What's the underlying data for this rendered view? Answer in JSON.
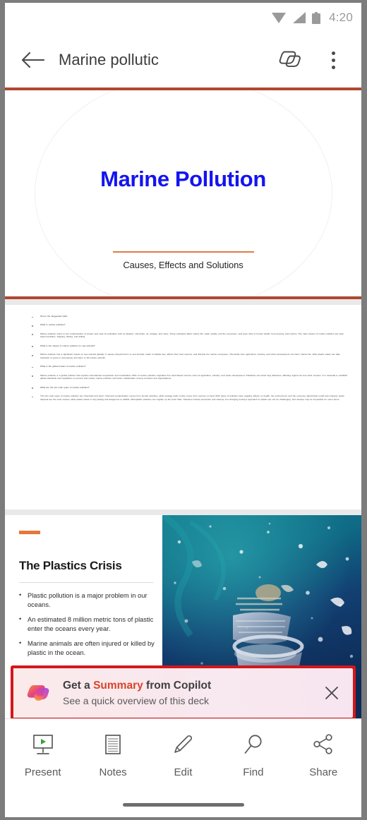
{
  "status_bar": {
    "time": "4:20",
    "icons": [
      "wifi-icon",
      "cellular-signal-icon",
      "battery-icon"
    ]
  },
  "app_bar": {
    "back_label": "back-arrow-icon",
    "title": "Marine pollutic",
    "copilot_action": "copilot-icon",
    "overflow_action": "more-options-icon"
  },
  "slides": [
    {
      "index": 1,
      "type": "title-slide",
      "title": "Marine Pollution",
      "subtitle": "Causes, Effects and Solutions",
      "title_color": "#1414f0",
      "accent_color": "#e07b4a",
      "border_color": "#b0482f"
    },
    {
      "index": 2,
      "type": "qa-text-slide",
      "lines": [
        {
          "kind": "q",
          "text": "Here's the Suggested Q&A:"
        },
        {
          "kind": "q",
          "text": "What is marine pollution?"
        },
        {
          "kind": "a",
          "text": "Marine pollution refers to the contamination of oceans and seas by pollutants such as plastics, chemicals, oil, sewage, and noise. These pollutants affect marine life, water quality, and the ecosystem, and pose risks to human health, food security, and tourism. The main causes of marine pollution are land-based activities, shipping, fishing, and drilling."
        },
        {
          "kind": "q",
          "text": "What is the impact of marine pollution on sea animals?"
        },
        {
          "kind": "a",
          "text": "Marine pollution has a significant impact on sea animals globally. It causes physical harm to sea animals, leads to habitat loss, affects their food sources, and disrupts the marine ecosystem. Chemicals from agriculture, industry, and urban development can harm marine life, while plastic waste can take hundreds of years to decompose and harm or kill marine animals."
        },
        {
          "kind": "q",
          "text": "What is the global impact of marine pollution?"
        },
        {
          "kind": "a",
          "text": "Marine pollution is a global problem that requires international cooperation and coordination. 80% of marine pollution originates from land-based sources such as agriculture, industry, and urban development. Pollutants can travel long distances, affecting regions far from their sources. It is essential to establish global standards and regulations to prevent and reduce marine pollution and foster collaboration among countries and organizations."
        },
        {
          "kind": "q",
          "text": "What are the two main types of marine pollution?"
        },
        {
          "kind": "a",
          "text": "The two main types of marine pollution are chemicals and trash. Chemical contamination comes from human activities, while sewage trash mostly comes from sources on land. Both types of pollution have negative effects on health, the environment, and the economy. Agricultural runoff and improper waste disposal are the main causes; while plastic waste is long lasting and dangerous to wildlife. Microplastic pollution can migrate up the food chain. Solutions include prevention and cleanup, but changing society's approach to plastic use can be challenging, and cleanup may be impossible for some items."
        }
      ]
    },
    {
      "index": 3,
      "type": "content-slide",
      "title": "The Plastics Crisis",
      "accent_color": "#e5763c",
      "bullets": [
        "Plastic pollution is a major problem in our oceans.",
        "An estimated 8 million metric tons of plastic enter the oceans every year.",
        "Marine animals are often injured or killed by plastic in the ocean."
      ],
      "image_alt": "underwater-plastic-debris-photo"
    }
  ],
  "copilot_banner": {
    "title_prefix": "Get a ",
    "title_highlight": "Summary",
    "title_suffix": " from Copilot",
    "subtitle": "See a quick overview of this deck",
    "logo": "copilot-logo-icon",
    "close_label": "close-icon",
    "highlight_color": "#d9442b",
    "outline_color": "#d3171b"
  },
  "bottom_toolbar": {
    "items": [
      {
        "label": "Present",
        "icon": "present-screen-icon"
      },
      {
        "label": "Notes",
        "icon": "notes-document-icon"
      },
      {
        "label": "Edit",
        "icon": "pencil-edit-icon"
      },
      {
        "label": "Find",
        "icon": "magnifier-search-icon"
      },
      {
        "label": "Share",
        "icon": "share-nodes-icon"
      }
    ]
  }
}
